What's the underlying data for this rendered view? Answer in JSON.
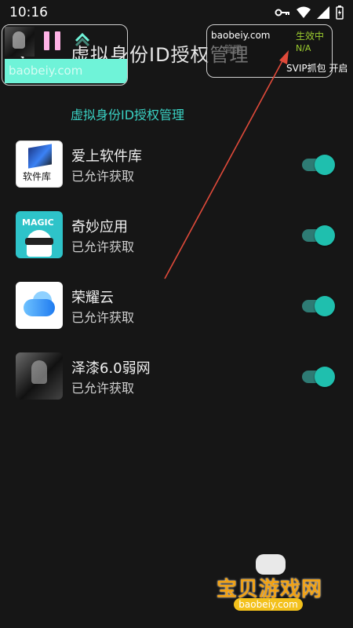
{
  "status_bar": {
    "time": "10:16"
  },
  "header": {
    "title": "虚拟身份ID授权管理"
  },
  "overlay_left": {
    "watermark": "baobeiy.com"
  },
  "overlay_right": {
    "site": "baobeiy.com",
    "status": "生效中",
    "faint": "管理",
    "value": "N/A",
    "svip": "SVIP抓包 开启"
  },
  "section": {
    "title": "虚拟身份ID授权管理"
  },
  "apps": [
    {
      "name": "爱上软件库",
      "status": "已允许获取",
      "icon_label": "软件库",
      "enabled": true
    },
    {
      "name": "奇妙应用",
      "status": "已允许获取",
      "icon_label": "MAGIC",
      "enabled": true
    },
    {
      "name": "荣耀云",
      "status": "已允许获取",
      "enabled": true
    },
    {
      "name": "泽漆6.0弱网",
      "status": "已允许获取",
      "enabled": true
    }
  ],
  "watermark_bottom": {
    "brand": "宝贝游戏网",
    "url": "baobeiy.com"
  },
  "colors": {
    "accent": "#1fbfae",
    "section": "#3ad2c4",
    "arrow": "#e04a3a",
    "brand": "#f1a215"
  }
}
